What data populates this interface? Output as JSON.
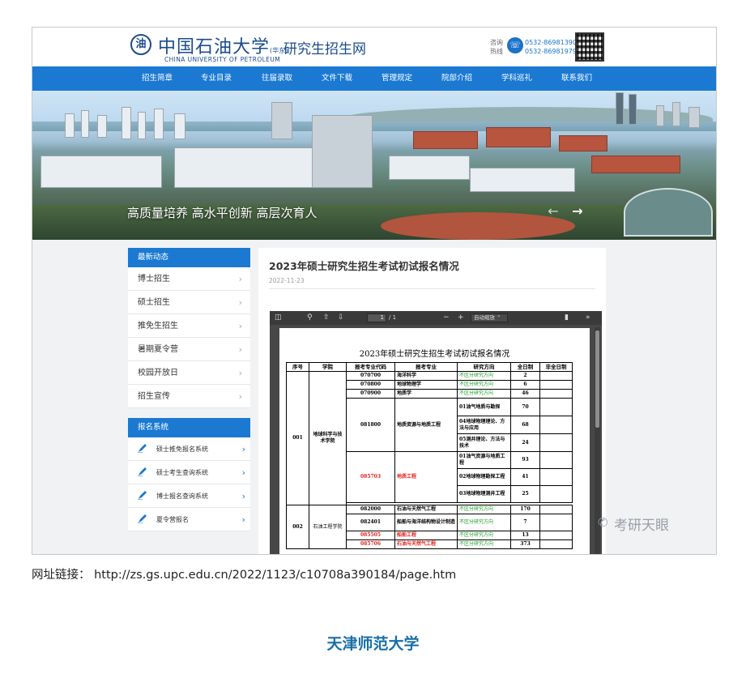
{
  "header": {
    "logo_cn": "中国石油大学",
    "logo_sub": "(华东)",
    "logo_title": "研究生招生网",
    "logo_en": "CHINA UNIVERSITY OF PETROLEUM",
    "hotline_label": "咨询热线",
    "hotline_numbers": [
      "0532-86981390",
      "0532-86981979"
    ]
  },
  "nav": {
    "items": [
      "招生简章",
      "专业目录",
      "往届录取",
      "文件下载",
      "管理规定",
      "院部介绍",
      "学科巡礼",
      "联系我们"
    ]
  },
  "banner": {
    "slogan": "高质量培养 高水平创新 高层次育人",
    "prev_glyph": "←",
    "next_glyph": "→"
  },
  "sidebar": {
    "news_heading": "最新动态",
    "news_items": [
      "博士招生",
      "硕士招生",
      "推免生招生",
      "暑期夏令营",
      "校园开放日",
      "招生宣传"
    ],
    "system_heading": "报名系统",
    "system_items": [
      "硕士推免报名系统",
      "硕士考生查询系统",
      "博士报名查询系统",
      "夏令营报名"
    ]
  },
  "article": {
    "title": "2023年硕士研究生招生考试初试报名情况",
    "date": "2022-11-23"
  },
  "pdf_viewer": {
    "page_current": "1",
    "page_total": "/ 1",
    "zoom_label": "自动缩放",
    "doc_title": "2023年硕士研究生招生考试初试报名情况",
    "columns": [
      "序号",
      "学院",
      "报考专业代码",
      "报考专业",
      "研究方向",
      "全日制",
      "非全日制"
    ],
    "group1": {
      "seq": "001",
      "college": "地球科学与技术学院",
      "rows": [
        {
          "code": "070700",
          "major": "海洋科学",
          "direction": "不区分研究方向",
          "full": "2"
        },
        {
          "code": "070800",
          "major": "地球物理学",
          "direction": "不区分研究方向",
          "full": "6"
        },
        {
          "code": "070900",
          "major": "地质学",
          "direction": "不区分研究方向",
          "full": "46"
        }
      ],
      "sub1": {
        "code": "081800",
        "major": "地质资源与地质工程",
        "dirs": [
          {
            "direction": "01油气地质与勘探",
            "full": "70"
          },
          {
            "direction": "04地球物理理论、方法与应用",
            "full": "68"
          },
          {
            "direction": "05测井理论、方法与技术",
            "full": "24"
          }
        ]
      },
      "sub2": {
        "code": "085703",
        "major": "地质工程",
        "dirs": [
          {
            "direction": "01油气资源与地质工程",
            "full": "93"
          },
          {
            "direction": "02地球物理勘探工程",
            "full": "41"
          },
          {
            "direction": "03地球物理测井工程",
            "full": "25"
          }
        ]
      }
    },
    "group2": {
      "seq": "002",
      "college": "石油工程学院",
      "rows": [
        {
          "code": "082000",
          "major": "石油与天然气工程",
          "direction": "不区分研究方向",
          "full": "170"
        },
        {
          "code": "082401",
          "major": "船舶与海洋结构物设计制造",
          "direction": "不区分研究方向",
          "full": "7"
        },
        {
          "code": "085505",
          "major": "船舶工程",
          "direction": "不区分研究方向",
          "full": "13"
        },
        {
          "code": "085706",
          "major": "石油与天然气工程",
          "direction": "不区分研究方向",
          "full": "373"
        }
      ]
    }
  },
  "watermark": "考研天眼",
  "url_line": "网址链接： http://zs.gs.upc.edu.cn/2022/1123/c10708a390184/page.htm",
  "footer_title": "天津师范大学",
  "colors": {
    "nav_blue": "#1b79d2",
    "brand_blue": "#1b4c8c",
    "green_text": "#1a9a2a",
    "red_text": "#e3221b",
    "footer_blue": "#1a6fa8"
  }
}
